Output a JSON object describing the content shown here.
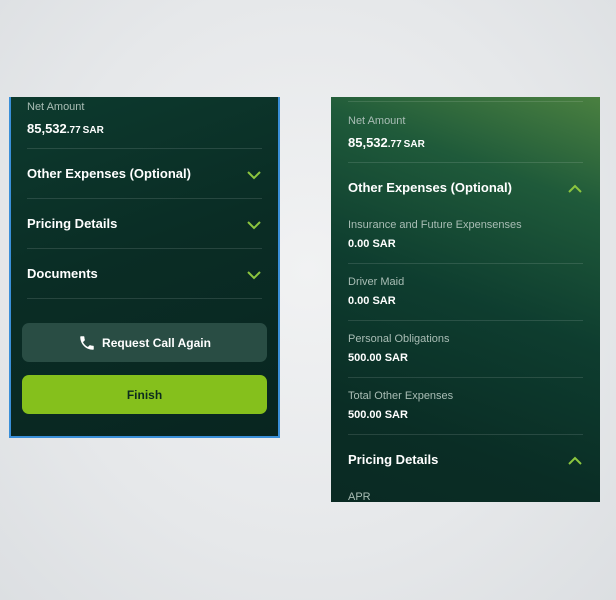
{
  "left_panel": {
    "net_amount_label": "Net Amount",
    "net_amount_main": "85,532",
    "net_amount_cents": ".77",
    "currency": "SAR",
    "sections": [
      {
        "title": "Other Expenses (Optional)",
        "state": "collapsed"
      },
      {
        "title": "Pricing Details",
        "state": "collapsed"
      },
      {
        "title": "Documents",
        "state": "collapsed"
      }
    ],
    "request_call_label": "Request Call Again",
    "finish_label": "Finish"
  },
  "right_panel": {
    "net_amount_label": "Net Amount",
    "net_amount_main": "85,532",
    "net_amount_cents": ".77",
    "currency": "SAR",
    "other_expenses_title": "Other Expenses (Optional)",
    "other_expenses_state": "expanded",
    "items": [
      {
        "label": "Insurance and Future Expensenses",
        "value": "0.00 SAR"
      },
      {
        "label": "Driver Maid",
        "value": "0.00 SAR"
      },
      {
        "label": "Personal Obligations",
        "value": "500.00 SAR"
      },
      {
        "label": "Total Other Expenses",
        "value": "500.00 SAR"
      }
    ],
    "pricing_title": "Pricing Details",
    "pricing_state": "expanded",
    "apr_label": "APR"
  },
  "colors": {
    "accent_green": "#85c01c",
    "chevron_green": "#8cc63f",
    "panel_dark": "#0a2d25"
  },
  "icons": [
    "chevron-down-icon",
    "chevron-up-icon",
    "phone-icon"
  ]
}
